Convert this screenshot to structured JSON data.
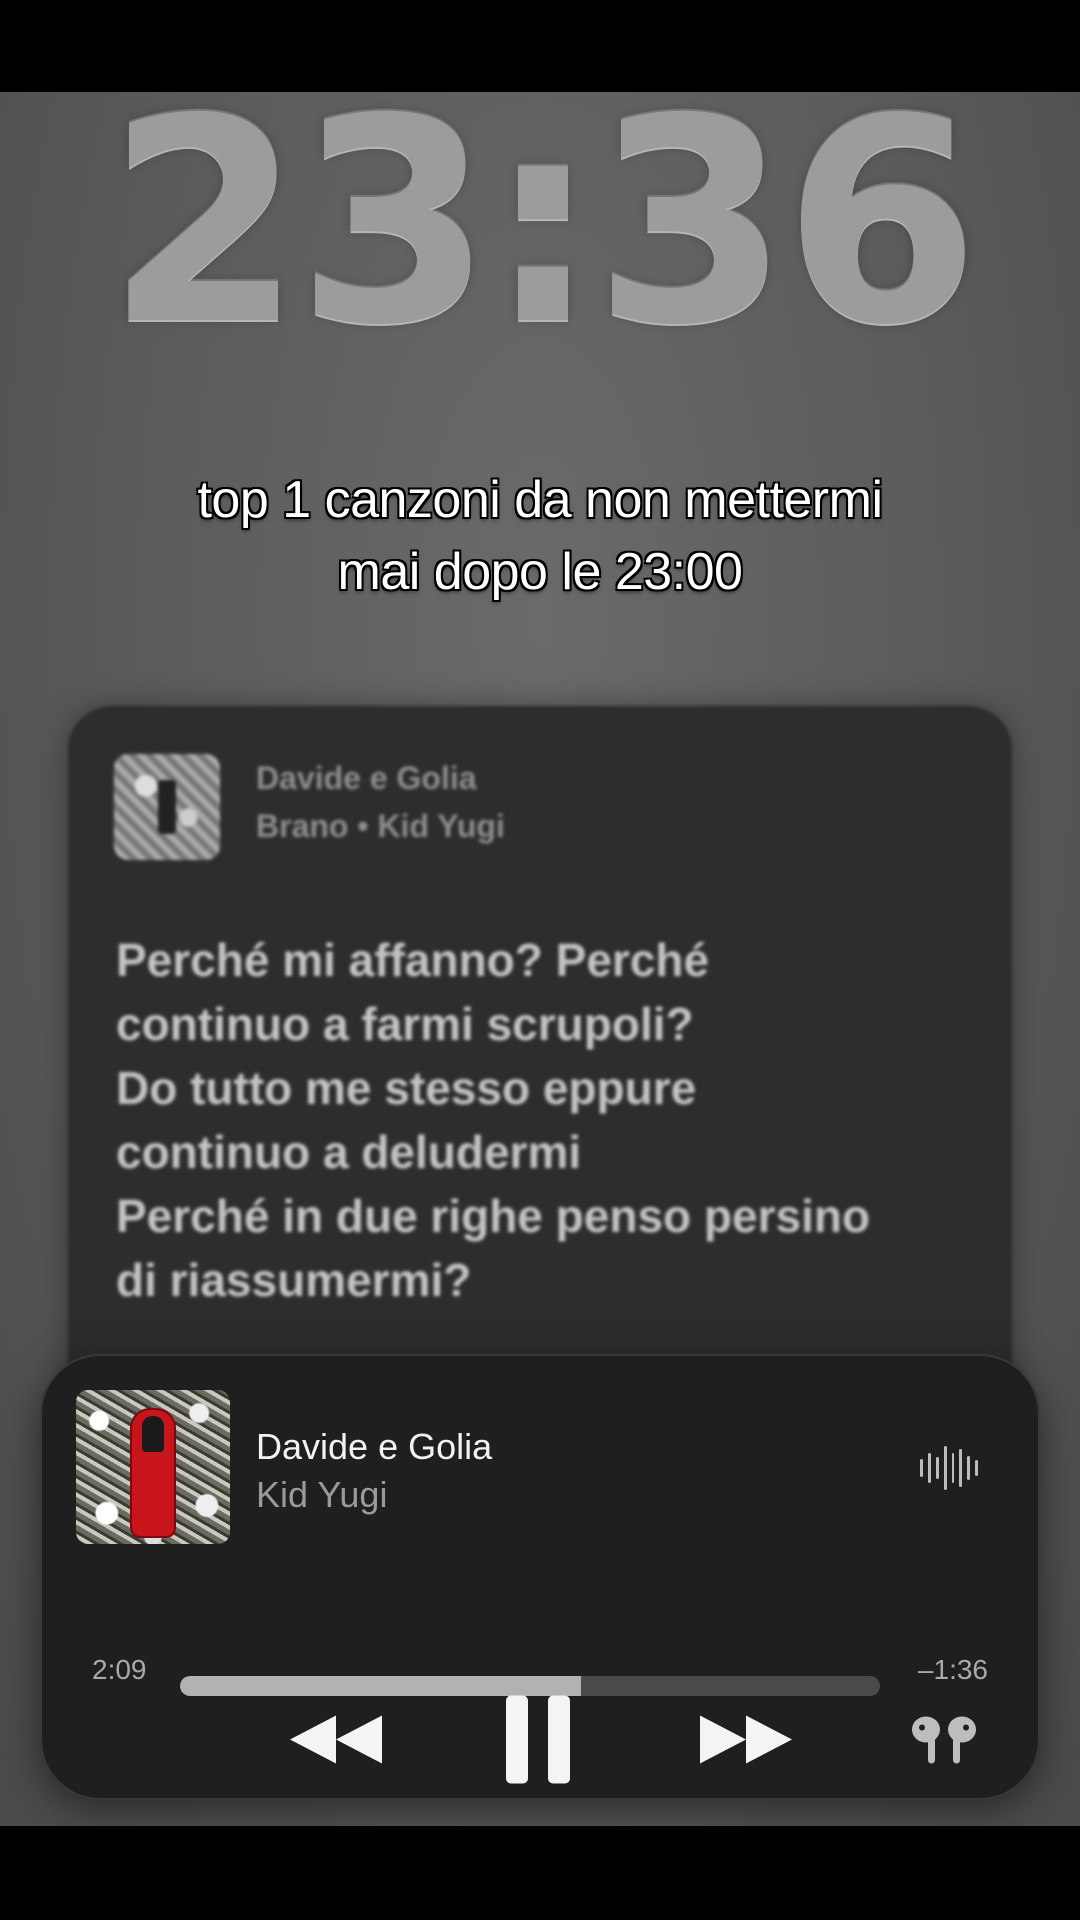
{
  "clock": {
    "time": "23:36"
  },
  "caption": {
    "line1": "top 1 canzoni da non mettermi",
    "line2": "mai dopo le 23:00"
  },
  "lyrics_card": {
    "song_title": "Davide e Golia",
    "subtitle": "Brano • Kid Yugi",
    "lines": [
      "Perché mi affanno? Perché",
      "continuo a farmi scrupoli?",
      "Do tutto me stesso eppure",
      "continuo a deludermi",
      "Perché in due righe penso persino",
      "di riassumermi?"
    ]
  },
  "now_playing": {
    "title": "Davide e Golia",
    "artist": "Kid Yugi",
    "elapsed": "2:09",
    "remaining": "–1:36",
    "progress_fraction": 0.573,
    "icons": {
      "waveform": "waveform-icon",
      "rewind": "rewind-icon",
      "pause": "pause-icon",
      "forward": "fast-forward-icon",
      "output": "airpods-icon"
    }
  },
  "colors": {
    "background": "#5c5c5c",
    "player_bg": "#1f1f1f",
    "progress_fill": "#b2b2b2",
    "progress_track": "#4a4a4a"
  }
}
